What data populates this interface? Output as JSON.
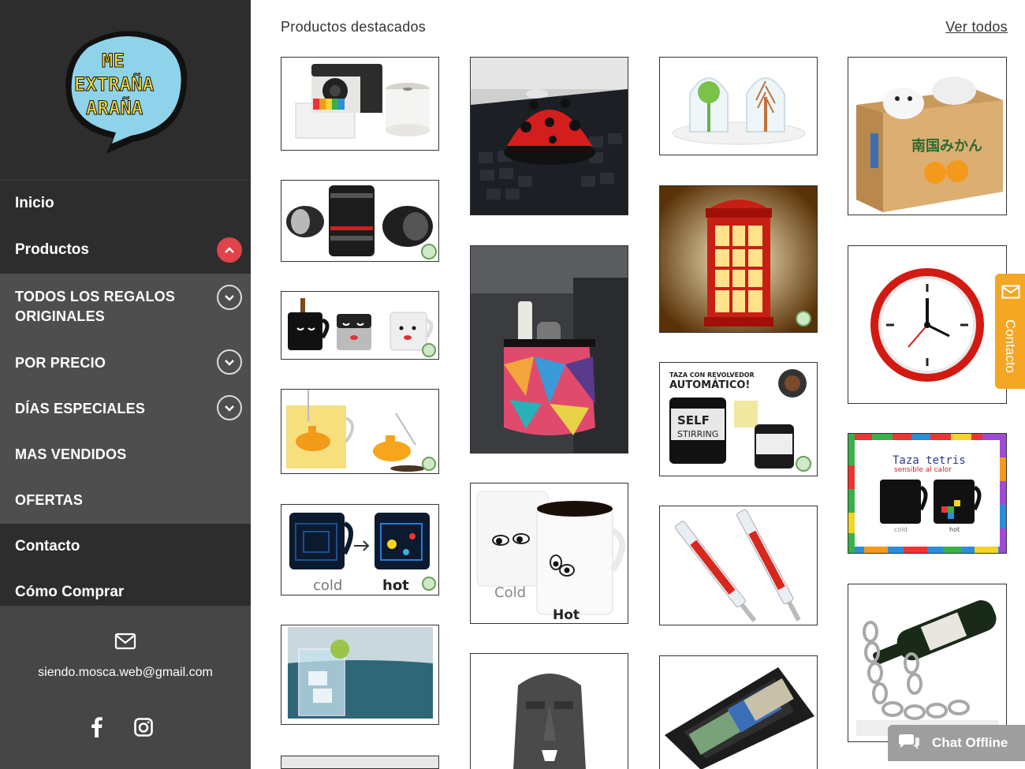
{
  "brand": {
    "logo_text": "ME EXTRAÑA ARAÑA"
  },
  "nav": {
    "inicio": "Inicio",
    "productos": "Productos",
    "sub": [
      {
        "label": "TODOS LOS REGALOS ORIGINALES",
        "has_toggle": true
      },
      {
        "label": "POR PRECIO",
        "has_toggle": true
      },
      {
        "label": "DÍAS ESPECIALES",
        "has_toggle": true
      },
      {
        "label": "MAS VENDIDOS",
        "has_toggle": false
      },
      {
        "label": "OFERTAS",
        "has_toggle": false
      }
    ],
    "contacto": "Contacto",
    "como_comprar": "Cómo Comprar"
  },
  "contact": {
    "email": "siendo.mosca.web@gmail.com"
  },
  "main": {
    "title": "Productos destacados",
    "view_all": "Ver todos"
  },
  "products": {
    "p2_cold": "cold",
    "p2_hot": "hot",
    "mug_cold": "Cold",
    "mug_hot": "Hot",
    "self_top": "TAZA CON REVOLVEDOR",
    "self_auto": "AUTOMÁTICO!",
    "self_mug": "SELF STIRRING MUG",
    "tetris_title": "Taza tetris",
    "tetris_sub": "sensible al calor",
    "tetris_cold": "cold",
    "tetris_hot": "hot",
    "box_text": "南国みかん"
  },
  "widgets": {
    "contact_tab": "Contacto",
    "chat": "Chat Offline"
  },
  "colors": {
    "sidebar": "#2d2d2d",
    "submenu": "#4e4e4e",
    "accent_red": "#e0434a",
    "contact_tab": "#f5a623",
    "chat": "#9e9e9e"
  }
}
